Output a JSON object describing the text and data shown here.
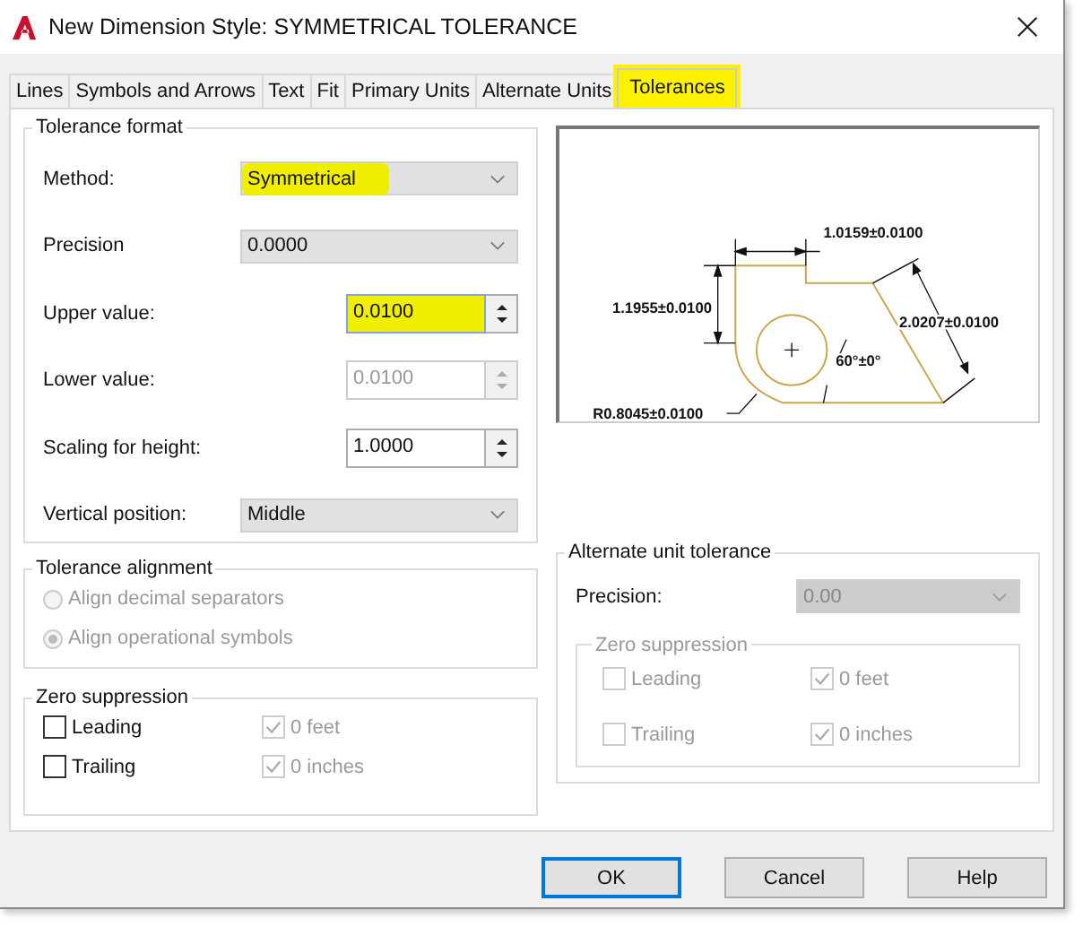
{
  "window": {
    "title": "New Dimension Style: SYMMETRICAL TOLERANCE"
  },
  "tabs": [
    {
      "label": "Lines",
      "selected": false,
      "highlighted": false
    },
    {
      "label": "Symbols and Arrows",
      "selected": false,
      "highlighted": false
    },
    {
      "label": "Text",
      "selected": false,
      "highlighted": false
    },
    {
      "label": "Fit",
      "selected": false,
      "highlighted": false
    },
    {
      "label": "Primary Units",
      "selected": false,
      "highlighted": false
    },
    {
      "label": "Alternate Units",
      "selected": false,
      "highlighted": false
    },
    {
      "label": "Tolerances",
      "selected": true,
      "highlighted": true
    }
  ],
  "tolerance_format": {
    "title": "Tolerance format",
    "fields": [
      {
        "kind": "dropdown",
        "label": "Method:",
        "value": "Symmetrical",
        "disabled": false,
        "highlighted": true
      },
      {
        "kind": "dropdown",
        "label": "Precision",
        "value": "0.0000",
        "disabled": false,
        "highlighted": false
      },
      {
        "kind": "spinner",
        "label": "Upper value:",
        "value": "0.0100",
        "disabled": false,
        "highlighted": true
      },
      {
        "kind": "spinner",
        "label": "Lower value:",
        "value": "0.0100",
        "disabled": true,
        "highlighted": false
      },
      {
        "kind": "spinner",
        "label": "Scaling for height:",
        "value": "1.0000",
        "disabled": false,
        "highlighted": false
      },
      {
        "kind": "dropdown",
        "label": "Vertical position:",
        "value": "Middle",
        "disabled": false,
        "highlighted": false
      }
    ]
  },
  "tolerance_alignment": {
    "title": "Tolerance alignment",
    "options": [
      {
        "label": "Align decimal separators",
        "selected": false,
        "disabled": true
      },
      {
        "label": "Align operational symbols",
        "selected": true,
        "disabled": true
      }
    ]
  },
  "zero_suppression": {
    "title": "Zero suppression",
    "checkboxes": [
      {
        "label": "Leading",
        "checked": false,
        "disabled": false
      },
      {
        "label": "0 feet",
        "checked": true,
        "disabled": true
      },
      {
        "label": "Trailing",
        "checked": false,
        "disabled": false
      },
      {
        "label": "0 inches",
        "checked": true,
        "disabled": true
      }
    ]
  },
  "preview": {
    "labels": [
      "1.0159±0.0100",
      "1.1955±0.0100",
      "2.0207±0.0100",
      "60°±0°",
      "R0.8045±0.0100"
    ]
  },
  "alternate_unit_tolerance": {
    "title": "Alternate unit tolerance",
    "precision": {
      "label": "Precision:",
      "value": "0.00",
      "disabled": true
    },
    "zero_suppression": {
      "title": "Zero suppression",
      "checkboxes": [
        {
          "label": "Leading",
          "checked": false,
          "disabled": true
        },
        {
          "label": "0 feet",
          "checked": true,
          "disabled": true
        },
        {
          "label": "Trailing",
          "checked": false,
          "disabled": true
        },
        {
          "label": "0 inches",
          "checked": true,
          "disabled": true
        }
      ]
    }
  },
  "buttons": [
    {
      "label": "OK",
      "default": true
    },
    {
      "label": "Cancel",
      "default": false
    },
    {
      "label": "Help",
      "default": false
    }
  ]
}
